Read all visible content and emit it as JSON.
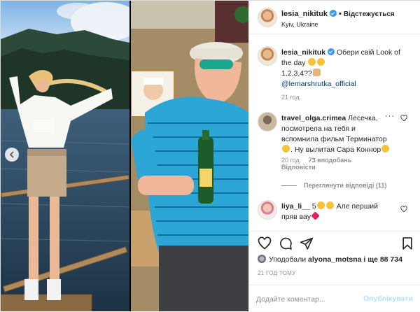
{
  "post": {
    "username": "lesia_nikituk",
    "follow_label": "Відстежується",
    "location": "Kyiv, Ukraine"
  },
  "caption": {
    "username": "lesia_nikituk",
    "text": "Обери свій Look of the day",
    "text2": "1,2,3,4??",
    "mention": "@lemarshrutka_official",
    "time": "21 год."
  },
  "comments": [
    {
      "username": "travel_olga.crimea",
      "text": "Лесечка, посмотрела на тебя и вспомнила фильм Терминатор",
      "text2": ". Ну вылитая Сара Коннор",
      "time": "20 год.",
      "likes": "73 вподобань",
      "reply": "Відповісти",
      "view_replies": "Переглянути відповіді (11)"
    },
    {
      "username": "liya_li__",
      "text": "5",
      "text2": "Але перший пряв вау"
    }
  ],
  "actions": {
    "liked_prefix": "Уподобали",
    "liked_user": "alyona_motsna",
    "liked_suffix": "і ще 88 734",
    "time_ago": "21 ГОД ТОМУ",
    "comment_placeholder": "Додайте коментар...",
    "publish_label": "Опублікувати"
  },
  "icons": [
    "heart-icon",
    "comment-icon",
    "share-icon",
    "bookmark-icon",
    "chevron-left-icon",
    "verified-icon",
    "more-icon"
  ]
}
